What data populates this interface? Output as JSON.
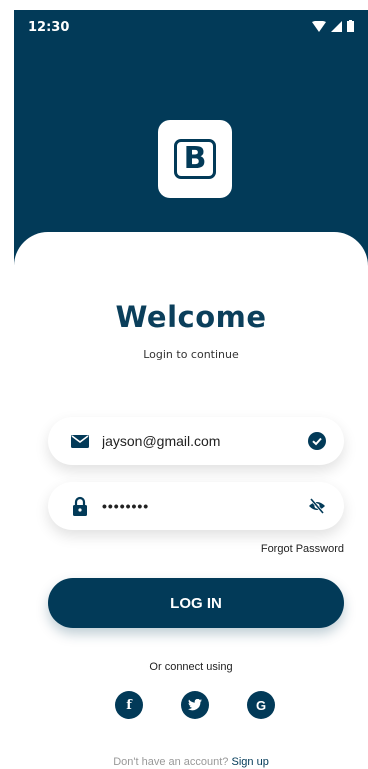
{
  "status_bar": {
    "time": "12:30"
  },
  "logo": {
    "letter": "B"
  },
  "welcome": {
    "title": "Welcome",
    "subtitle": "Login to continue"
  },
  "email": {
    "value": "jayson@gmail.com"
  },
  "password": {
    "value": "••••••••"
  },
  "forgot_password": "Forgot Password",
  "login_button": "LOG IN",
  "connect_text": "Or connect using",
  "social": {
    "facebook": "f",
    "google": "G"
  },
  "signup": {
    "prompt": "Don't have an account?",
    "link": "Sign up"
  },
  "colors": {
    "primary": "#023a58",
    "background": "#ffffff"
  }
}
